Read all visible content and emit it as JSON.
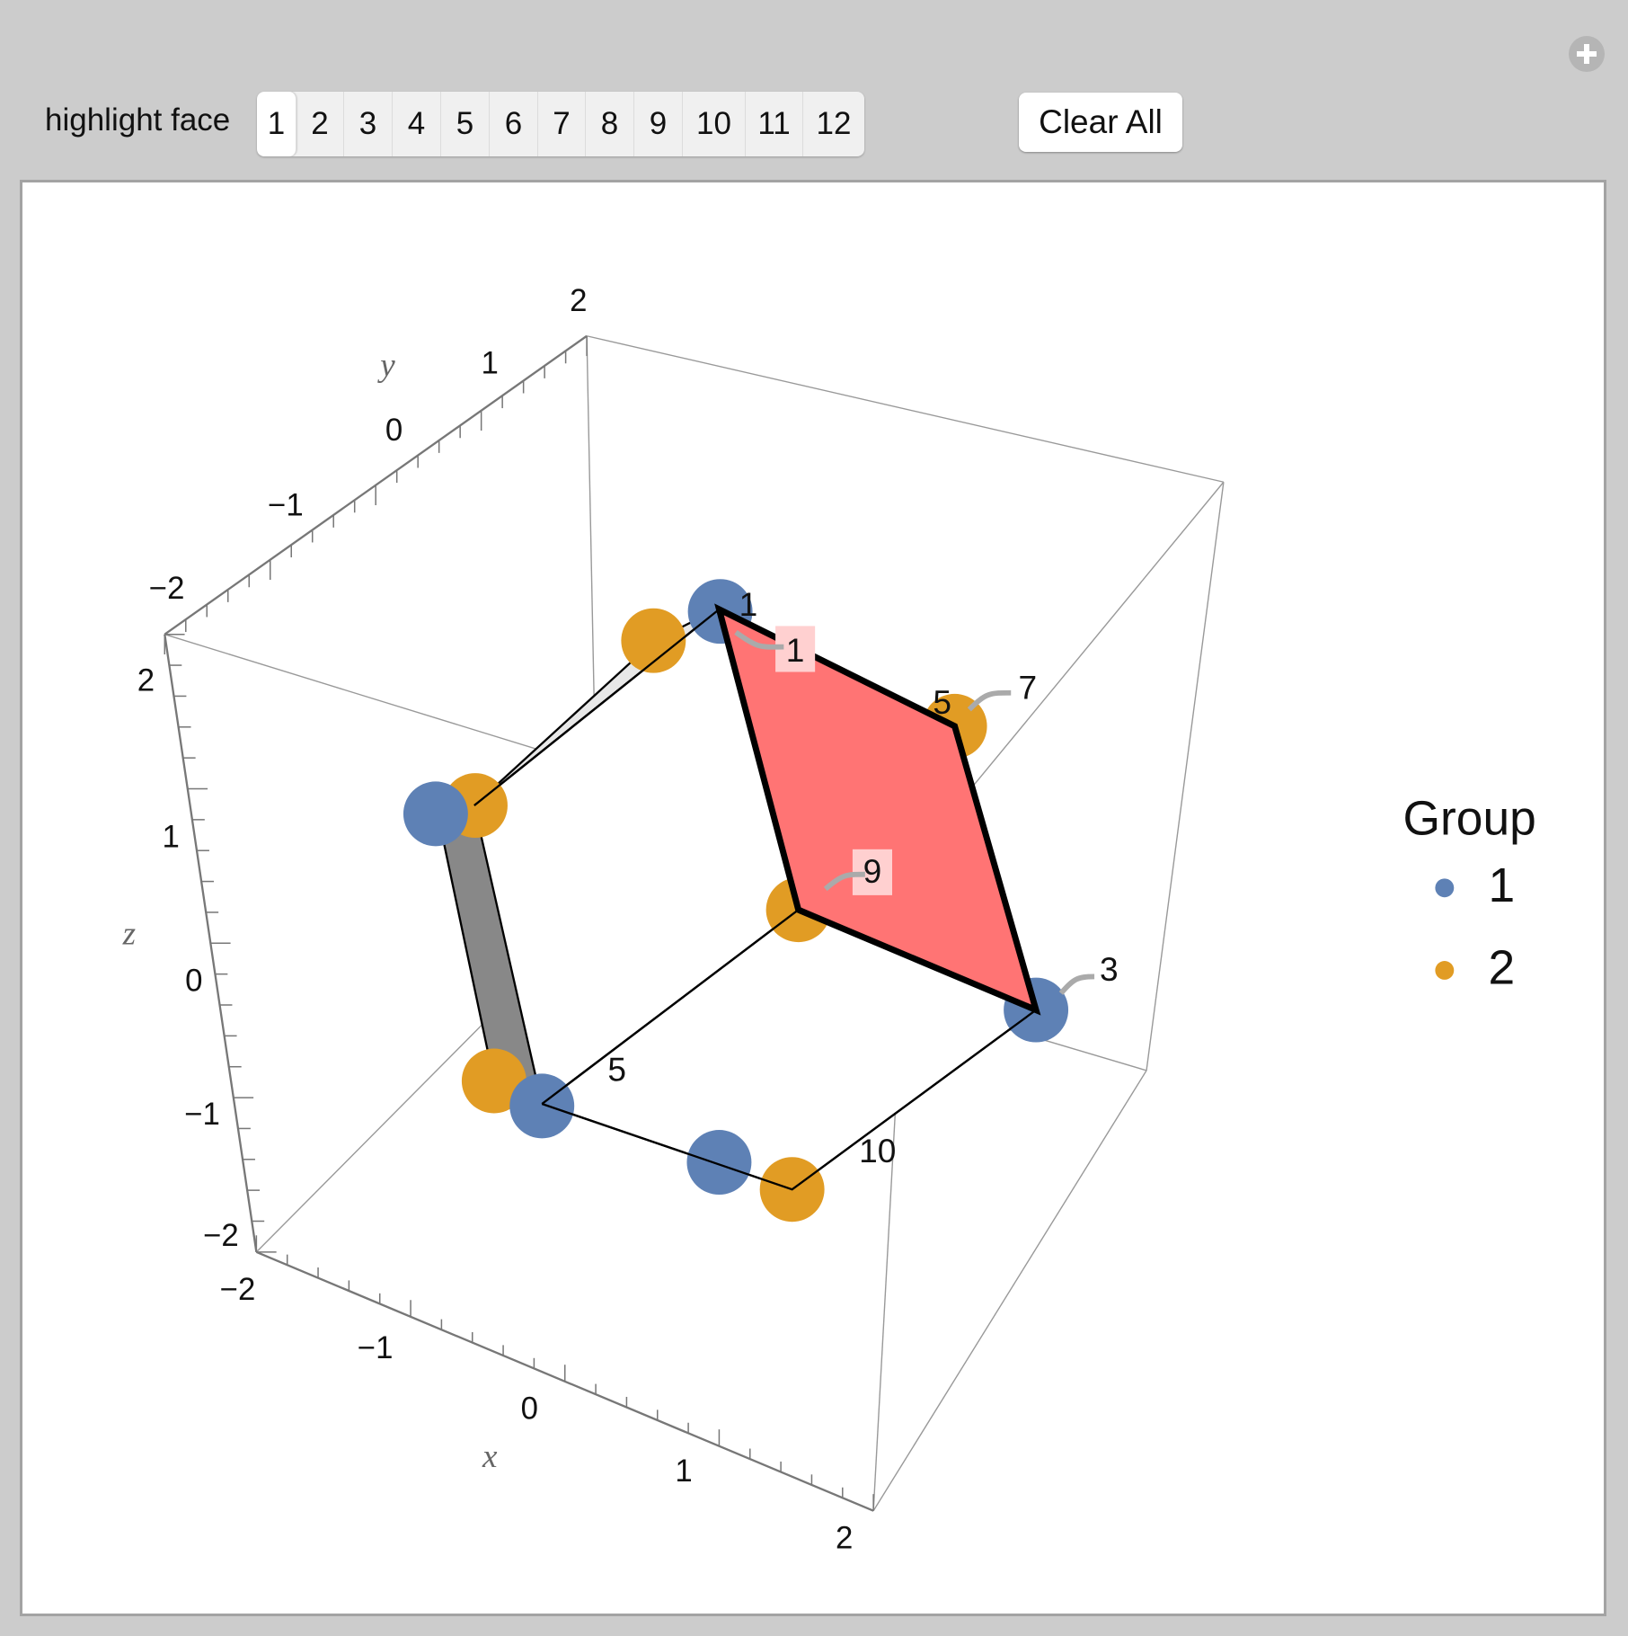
{
  "controls": {
    "label": "highlight face",
    "faces": [
      "1",
      "2",
      "3",
      "4",
      "5",
      "6",
      "7",
      "8",
      "9",
      "10",
      "11",
      "12"
    ],
    "selected_face": "1",
    "clear_label": "Clear All",
    "add_icon": "plus-circle-icon"
  },
  "chart_data": {
    "type": "scatter",
    "title": "",
    "xlabel": "x",
    "ylabel": "y",
    "zlabel": "z",
    "xlim": [
      -2,
      2
    ],
    "ylim": [
      -2,
      2
    ],
    "zlim": [
      -2,
      2
    ],
    "x_ticks": [
      "-2",
      "-1",
      "0",
      "1",
      "2"
    ],
    "y_ticks": [
      "-2",
      "-1",
      "0",
      "1",
      "2"
    ],
    "z_ticks": [
      "-2",
      "-1",
      "0",
      "1",
      "2"
    ],
    "legend": {
      "title": "Group",
      "placement": "right",
      "entries": [
        {
          "label": "1",
          "color": "#5e81b5"
        },
        {
          "label": "2",
          "color": "#e19c24"
        }
      ]
    },
    "highlighted_face": {
      "index": 1,
      "fill": "#ff7474",
      "vertex_labels": [
        "1",
        "7",
        "3",
        "9"
      ]
    },
    "point_labels": [
      "1",
      "1",
      "5",
      "7",
      "9",
      "3",
      "5",
      "10"
    ],
    "colors": {
      "group1": "#5e81b5",
      "group2": "#e19c24",
      "highlight": "#ff7474",
      "face_dark": "#888888",
      "face_light": "#e8e8e8"
    }
  }
}
